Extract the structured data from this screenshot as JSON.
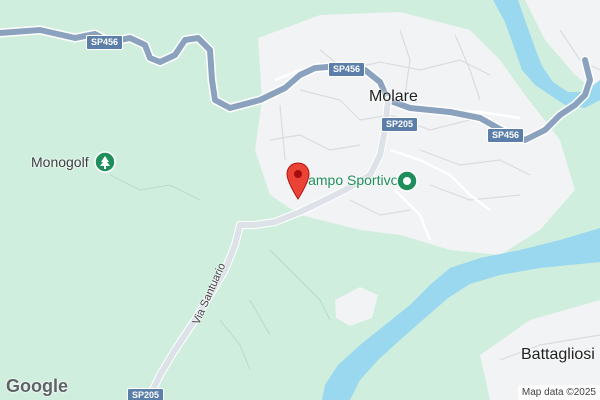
{
  "map": {
    "places": {
      "town": "Molare",
      "village": "Battagliosi",
      "poi_golf": "Monogolf",
      "poi_sport": "Campo Sportivo"
    },
    "roads": {
      "sp456_a": "SP456",
      "sp456_b": "SP456",
      "sp456_c": "SP456",
      "sp205_a": "SP205",
      "sp205_b": "SP205",
      "street": "Via Santuario"
    },
    "footer": {
      "logo": "Google",
      "attribution": "Map data ©2025"
    },
    "icons": {
      "marker": "location-pin-icon",
      "golf": "golf-park-icon",
      "sport": "sports-field-icon"
    },
    "colors": {
      "land": "#cfeedd",
      "urban": "#f1f3f4",
      "water": "#9ad8ef",
      "highway": "#8aa2bd",
      "marker": "#ea4335",
      "park_icon": "#1e8e5a"
    }
  }
}
